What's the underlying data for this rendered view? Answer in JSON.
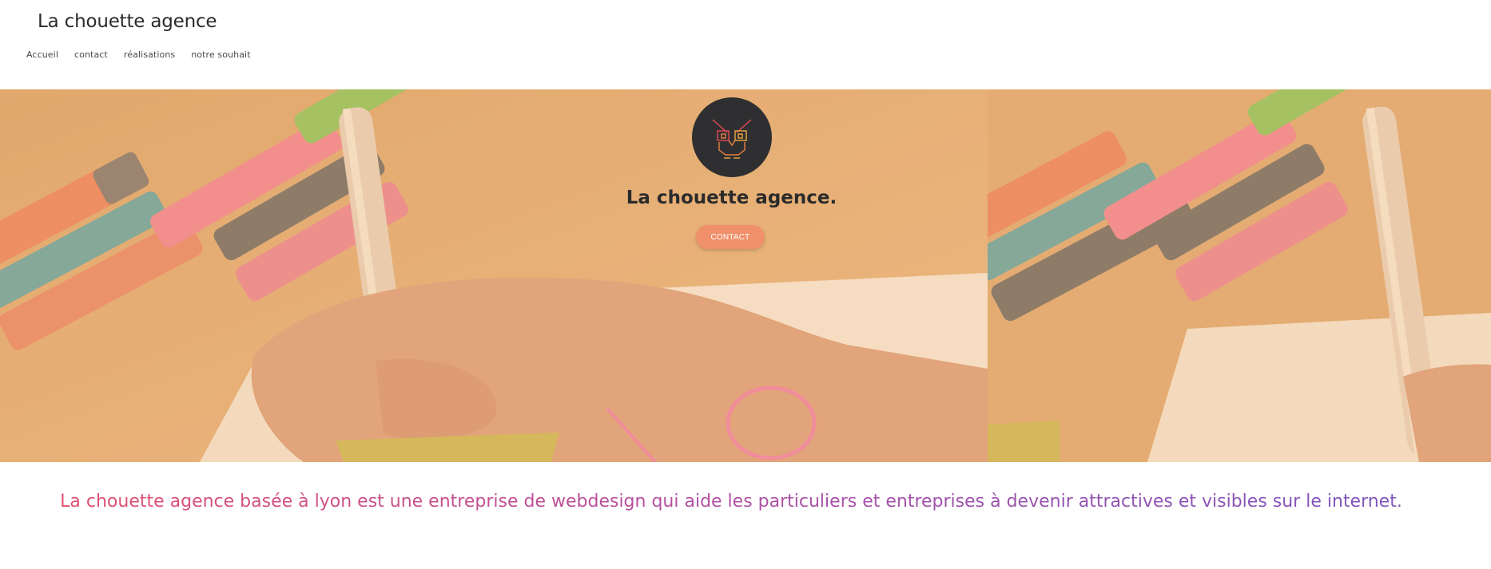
{
  "site": {
    "title": "La chouette agence"
  },
  "nav": {
    "items": [
      {
        "label": "Accueil"
      },
      {
        "label": "contact"
      },
      {
        "label": "réalisations"
      },
      {
        "label": "notre souhait"
      }
    ]
  },
  "hero": {
    "title": "La chouette agence.",
    "cta_label": "CONTACT",
    "logo_icon": "owl-icon",
    "overlay_color": "#f6c48c",
    "button_color": "#f0906a"
  },
  "tagline": {
    "text": "La chouette agence basée à lyon est une entreprise de webdesign qui aide les particuliers et entreprises à devenir attractives et visibles sur le internet.",
    "gradient_start": "#e2506f",
    "gradient_end": "#7f55bd"
  }
}
